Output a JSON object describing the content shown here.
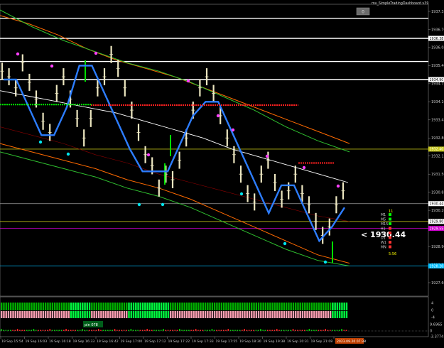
{
  "chart_data": {
    "type": "line",
    "symbol_instrument": "GOLD M1 (renko-style bars)",
    "indicator_title": "mv_SimpleTradingDashboard v39",
    "dashboard_button_label": "0",
    "price_callout": "< 1930.44",
    "dashboard": {
      "rows": [
        {
          "label": "M1",
          "color": "#00ff00"
        },
        {
          "label": "M5",
          "color": "#00ff00"
        },
        {
          "label": "M15",
          "color": "#00ff00"
        },
        {
          "label": "H1",
          "color": "#ff3030"
        },
        {
          "label": "H4",
          "color": "#ff3030"
        },
        {
          "label": "D1",
          "color": "#ff3030"
        },
        {
          "label": "W1",
          "color": "#ff3030"
        },
        {
          "label": "MN",
          "color": "#ff3030"
        }
      ],
      "count_label": "11",
      "timer": "5:56"
    },
    "y_axis": {
      "ticks": [
        "1937.35",
        "1936.70",
        "1936.05",
        "1935.40",
        "1934.75",
        "1934.10",
        "1933.45",
        "1932.80",
        "1932.15",
        "1931.50",
        "1930.85",
        "1930.20",
        "1929.55",
        "1928.90",
        "1928.25",
        "1927.60"
      ],
      "ylim": [
        1927.35,
        1937.75
      ]
    },
    "y_badges": [
      {
        "text": "1936.38",
        "color": "#ffffff"
      },
      {
        "text": "1934.90",
        "color": "#ffffff"
      },
      {
        "text": "1932.40",
        "color": "#c8c820"
      },
      {
        "text": "1930.44",
        "color": "#ffffff"
      },
      {
        "text": "1929.80",
        "color": "#ffffff"
      },
      {
        "text": "1929.55",
        "color": "#cc00cc"
      },
      {
        "text": "1928.20",
        "color": "#00bfff"
      }
    ],
    "x_axis": {
      "ticks": [
        "19 Sep 15:54",
        "19 Sep 16:03",
        "19 Sep 16:18",
        "19 Sep 16:33",
        "19 Sep 16:42",
        "19 Sep 17:00",
        "19 Sep 17:12",
        "19 Sep 17:22",
        "19 Sep 17:33",
        "19 Sep 17:55",
        "19 Sep 18:30",
        "19 Sep 19:38",
        "19 Sep 20:31",
        "19 Sep 21:08",
        "20 Sep 03:05"
      ],
      "current_time_label": "2023.09.20 07:38"
    },
    "sub_indicator": {
      "labels": [
        "4",
        "0",
        "-4"
      ],
      "histogram_labels": [
        "9.6965",
        "0",
        "-3.3774"
      ],
      "annotation": "pin 078"
    },
    "horizontal_levels": [
      {
        "price": 1937.1,
        "color": "#ffffff"
      },
      {
        "price": 1936.38,
        "color": "#ffffff"
      },
      {
        "price": 1935.55,
        "color": "#ffffff"
      },
      {
        "price": 1934.9,
        "color": "#ffffff"
      },
      {
        "price": 1932.4,
        "color": "#b4b414"
      },
      {
        "price": 1930.44,
        "color": "#a0a0a0"
      },
      {
        "price": 1929.8,
        "color": "#b4b414"
      },
      {
        "price": 1929.55,
        "color": "#cc00cc"
      },
      {
        "price": 1928.2,
        "color": "#00bfff"
      }
    ],
    "series": [
      {
        "name": "",
        "color": "#ffffff",
        "values": [
          1934.5,
          1934.3,
          1934.1,
          1933.9,
          1933.7,
          1933.4,
          1933.1,
          1932.8,
          1932.4,
          1932.1,
          1931.8,
          1931.5,
          1931.2
        ]
      },
      {
        "name": "",
        "color": "#2d7dff",
        "values": [
          1934.9,
          1934.1,
          1935.4,
          1933.9,
          1932.1,
          1934.0,
          1933.1,
          1931.6,
          1931.8,
          1930.4,
          1929.6,
          1930.2
        ]
      },
      {
        "name": "",
        "color": "#ff6a00",
        "values": [
          1937.2,
          1936.5,
          1935.8,
          1935.1,
          1934.5,
          1934.0,
          1933.3,
          1932.5
        ]
      }
    ]
  }
}
